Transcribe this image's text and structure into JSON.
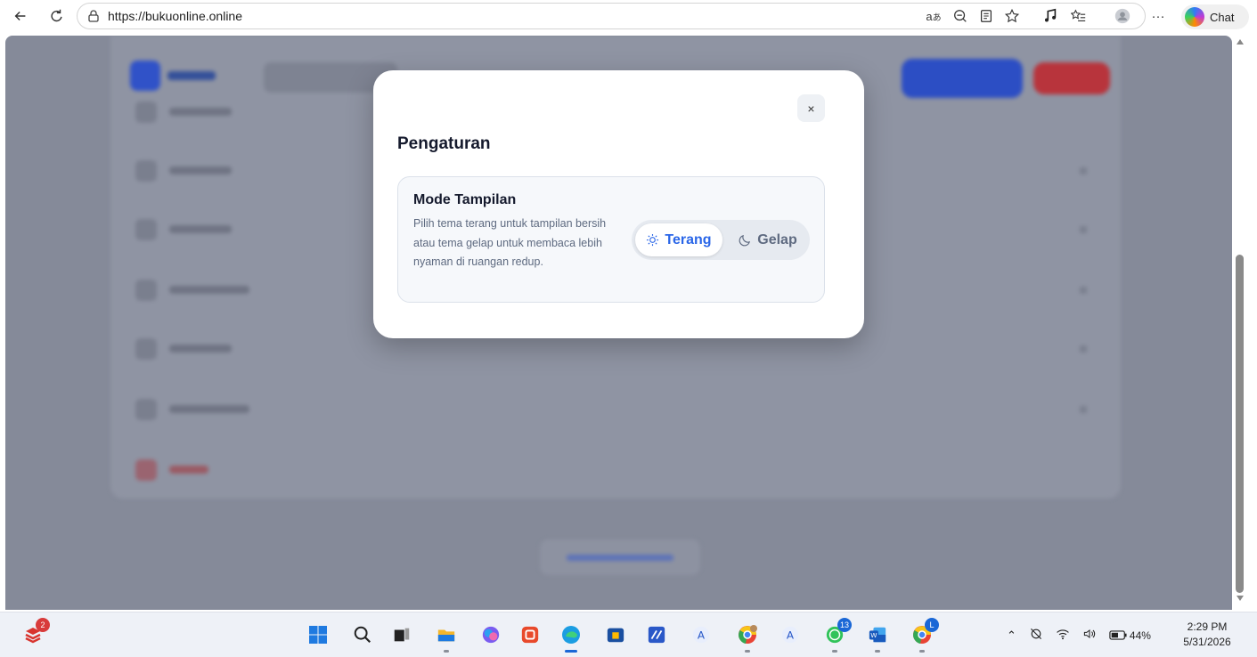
{
  "browser": {
    "url": "https://bukuonline.online",
    "chat_label": "Chat",
    "icons": [
      "back-icon",
      "refresh-icon",
      "lock-icon",
      "read-aloud-icon",
      "zoom-out-icon",
      "reader-mode-icon",
      "favorite-icon",
      "music-icon",
      "favorites-bar-icon",
      "profile-icon",
      "more-icon",
      "copilot-icon"
    ]
  },
  "modal": {
    "title": "Pengaturan",
    "close_label": "×",
    "display_mode": {
      "title": "Mode Tampilan",
      "description": "Pilih tema terang untuk tampilan bersih atau tema gelap untuk membaca lebih nyaman di ruangan redup.",
      "options": [
        {
          "label": "Terang",
          "icon": "sun-icon",
          "selected": true
        },
        {
          "label": "Gelap",
          "icon": "moon-icon",
          "selected": false
        }
      ]
    }
  },
  "colors": {
    "accent": "#2a66e8",
    "overlay": "#858a99",
    "danger": "#b8343c"
  },
  "taskbar": {
    "apps": [
      {
        "name": "start-icon"
      },
      {
        "name": "search-icon"
      },
      {
        "name": "task-view-icon"
      },
      {
        "name": "file-explorer-icon"
      },
      {
        "name": "copilot-app-icon"
      },
      {
        "name": "office-icon"
      },
      {
        "name": "edge-icon",
        "active": true
      },
      {
        "name": "store-icon"
      },
      {
        "name": "visual-studio-icon"
      },
      {
        "name": "app-a-icon"
      },
      {
        "name": "chrome-profile-icon"
      },
      {
        "name": "app-a2-icon"
      },
      {
        "name": "whatsapp-icon",
        "badge": "13"
      },
      {
        "name": "word-icon"
      },
      {
        "name": "chrome-icon",
        "badge": "L"
      }
    ],
    "widget_badge": "2",
    "tray": {
      "battery": "44%"
    },
    "clock": {
      "time": "2:29 PM",
      "date": "5/31/2026"
    }
  }
}
